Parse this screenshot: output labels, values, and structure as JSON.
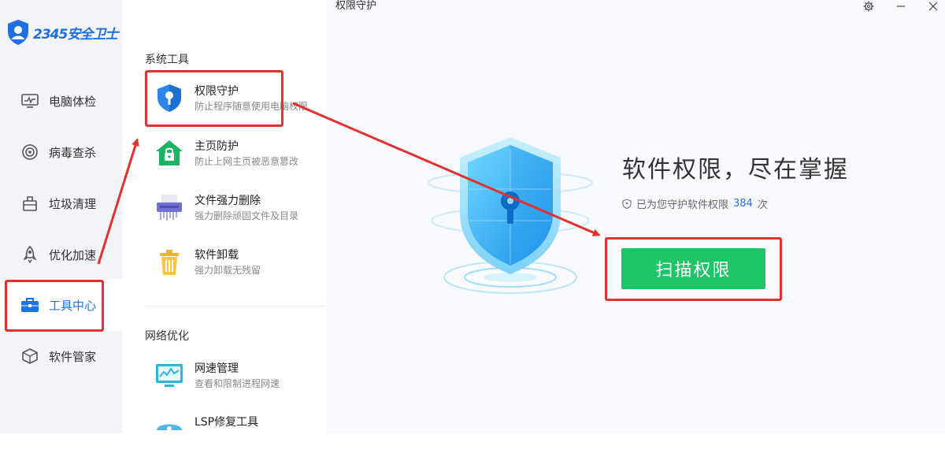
{
  "app": {
    "logo_text": "2345安全卫士"
  },
  "nav": {
    "items": [
      {
        "label": "电脑体检",
        "icon": "monitor-icon"
      },
      {
        "label": "病毒查杀",
        "icon": "target-icon"
      },
      {
        "label": "垃圾清理",
        "icon": "trash-bin-icon"
      },
      {
        "label": "优化加速",
        "icon": "rocket-icon"
      },
      {
        "label": "工具中心",
        "icon": "toolbox-icon",
        "active": true
      },
      {
        "label": "软件管家",
        "icon": "cube-icon"
      }
    ]
  },
  "tools": {
    "system_section": "系统工具",
    "network_section": "网络优化",
    "items": [
      {
        "name": "权限守护",
        "desc": "防止程序随意使用电脑权限",
        "icon": "shield-key-icon"
      },
      {
        "name": "主页防护",
        "desc": "防止上网主页被恶意篡改",
        "icon": "home-lock-icon"
      },
      {
        "name": "文件强力删除",
        "desc": "强力删除顽固文件及目录",
        "icon": "shredder-icon"
      },
      {
        "name": "软件卸载",
        "desc": "强力卸载无残留",
        "icon": "trash-can-icon"
      },
      {
        "name": "网速管理",
        "desc": "查看和限制进程网速",
        "icon": "speed-monitor-icon"
      },
      {
        "name": "LSP修复工具",
        "desc": "",
        "icon": "repair-icon"
      }
    ]
  },
  "main": {
    "window_title": "权限守护",
    "headline": "软件权限，尽在掌握",
    "protect_prefix": "已为您守护软件权限",
    "protect_count": "384",
    "protect_suffix": "次",
    "scan_button": "扫描权限"
  },
  "colors": {
    "accent": "#1a73e8",
    "scan_green": "#1ec566",
    "annotation_red": "#e53030"
  }
}
